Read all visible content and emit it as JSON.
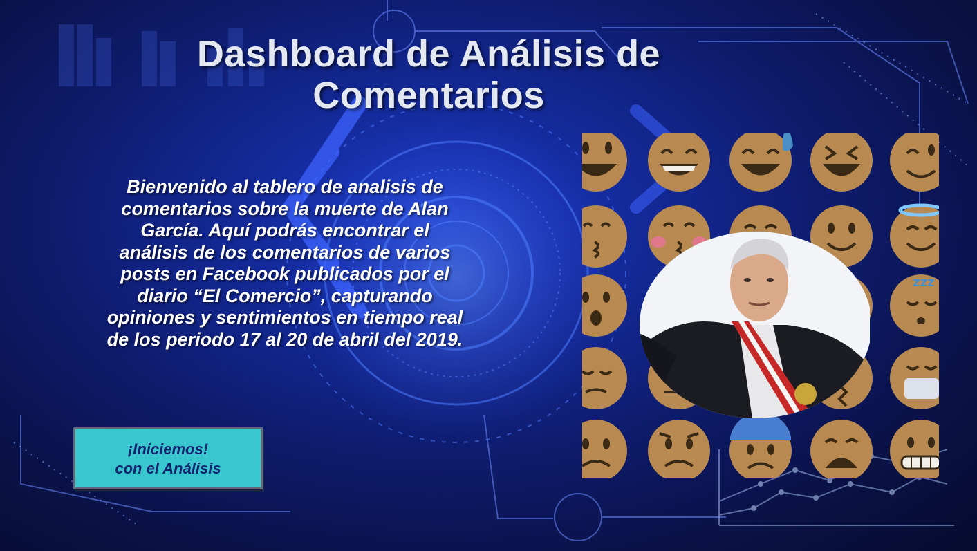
{
  "page": {
    "title_line1": "Dashboard de Análisis de",
    "title_line2": "Comentarios"
  },
  "intro": {
    "lines": [
      "Bienvenido al tablero de analisis de",
      "comentarios sobre la muerte de Alan",
      "García. Aquí podrás encontrar el",
      "análisis de los comentarios de varios",
      "posts en Facebook publicados por el",
      "diario “El Comercio”, capturando",
      "opiniones y sentimientos en tiempo real",
      "de los periodo 17 al 20 de abril del 2019."
    ]
  },
  "cta": {
    "line1": "¡Iniciemos!",
    "line2": "con el Análisis"
  },
  "colors": {
    "accent_button": "#38c7cf",
    "title_text": "#e4e8f0",
    "emoji_face": "#b88a52"
  },
  "decor": {
    "emoji_set": [
      "grinning-face",
      "grin-face",
      "sweat-smile-face",
      "laughing-face",
      "winking-face",
      "kissing-face",
      "kissing-blush-face",
      "smiling-blush-face",
      "slight-smile-face",
      "halo-face",
      "hushed-face",
      "surprised-face",
      "relieved-face",
      "tired-face",
      "sleeping-face",
      "pensive-face",
      "neutral-face",
      "angry-face",
      "confounded-face",
      "medical-mask-face",
      "frowning-face",
      "worried-face",
      "anxious-face",
      "weary-face",
      "grimacing-face"
    ]
  }
}
